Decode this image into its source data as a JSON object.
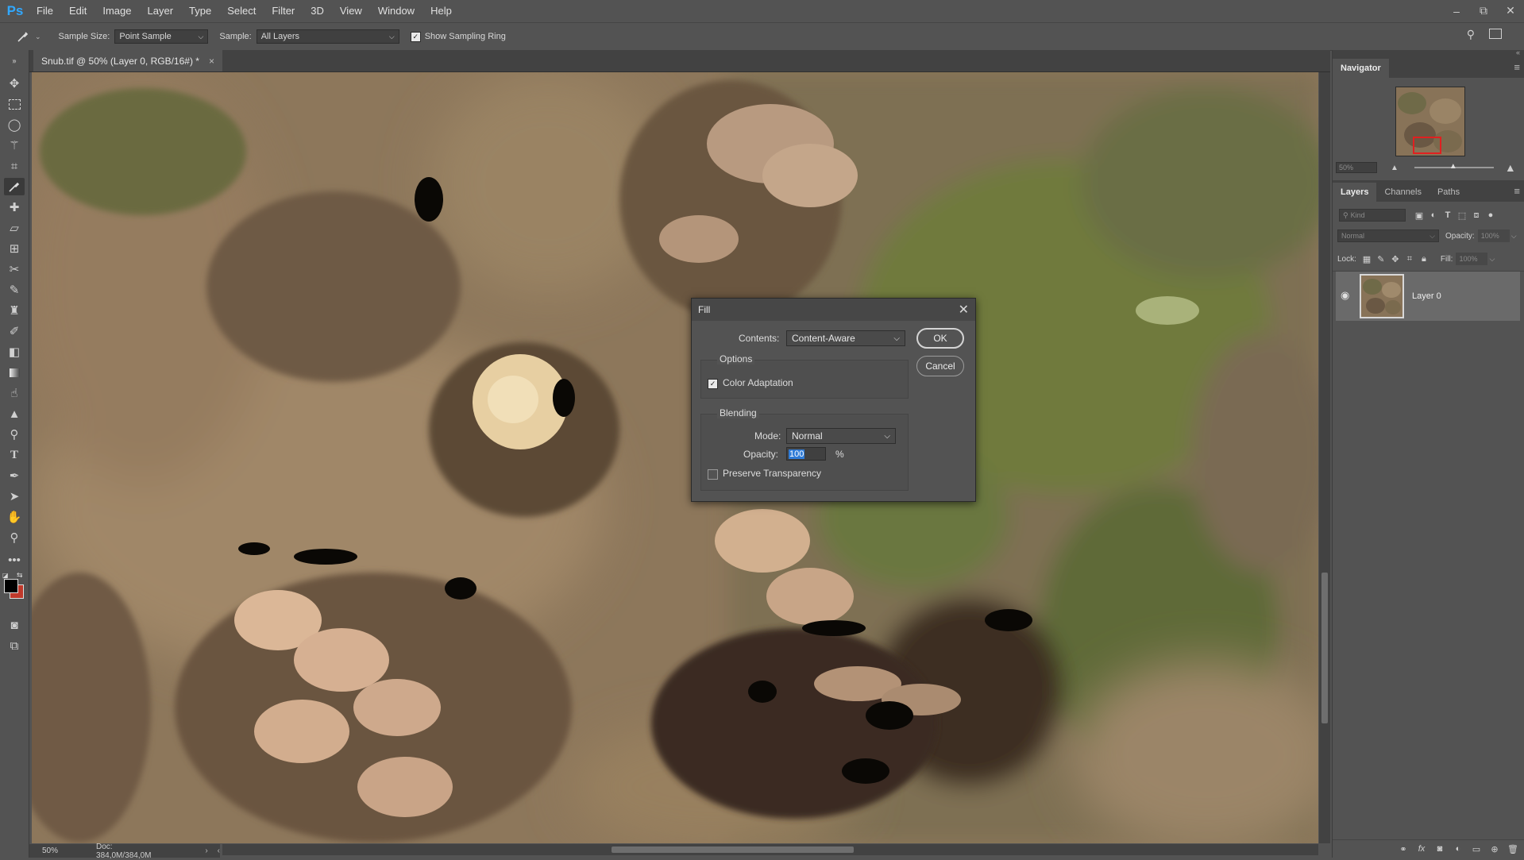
{
  "app": {
    "logo": "Ps"
  },
  "menu": [
    "File",
    "Edit",
    "Image",
    "Layer",
    "Type",
    "Select",
    "Filter",
    "3D",
    "View",
    "Window",
    "Help"
  ],
  "window_controls": {
    "minimize": "–",
    "restore": "⧉",
    "close": "✕"
  },
  "options_bar": {
    "sample_size_label": "Sample Size:",
    "sample_size_value": "Point Sample",
    "sample_label": "Sample:",
    "sample_value": "All Layers",
    "show_ring_label": "Show Sampling Ring",
    "show_ring_checked": true
  },
  "document": {
    "tab_title": "Snub.tif @ 50% (Layer 0, RGB/16#) *",
    "tab_close": "×"
  },
  "status": {
    "zoom": "50%",
    "doc": "Doc: 384,0M/384,0M"
  },
  "navigator": {
    "tab": "Navigator",
    "zoom": "50%"
  },
  "layers_panel": {
    "tabs": [
      "Layers",
      "Channels",
      "Paths"
    ],
    "kind_placeholder": "Kind",
    "blend_mode": "Normal",
    "opacity_label": "Opacity:",
    "opacity_value": "100%",
    "lock_label": "Lock:",
    "fill_label": "Fill:",
    "fill_value": "100%",
    "layers": [
      {
        "name": "Layer 0",
        "visible": true
      }
    ]
  },
  "fill_dialog": {
    "title": "Fill",
    "contents_label": "Contents:",
    "contents_value": "Content-Aware",
    "options_legend": "Options",
    "color_adaptation_label": "Color Adaptation",
    "color_adaptation_checked": true,
    "blending_legend": "Blending",
    "mode_label": "Mode:",
    "mode_value": "Normal",
    "opacity_label": "Opacity:",
    "opacity_value": "100",
    "opacity_unit": "%",
    "preserve_label": "Preserve Transparency",
    "preserve_checked": false,
    "ok_label": "OK",
    "cancel_label": "Cancel"
  },
  "colors": {
    "ui_bg": "#535353",
    "ui_dark": "#424242",
    "accent_blue": "#31a8ff",
    "selection_blue": "#2f7bd6",
    "foreground_swatch": "#000000",
    "background_swatch": "#c0392b"
  }
}
